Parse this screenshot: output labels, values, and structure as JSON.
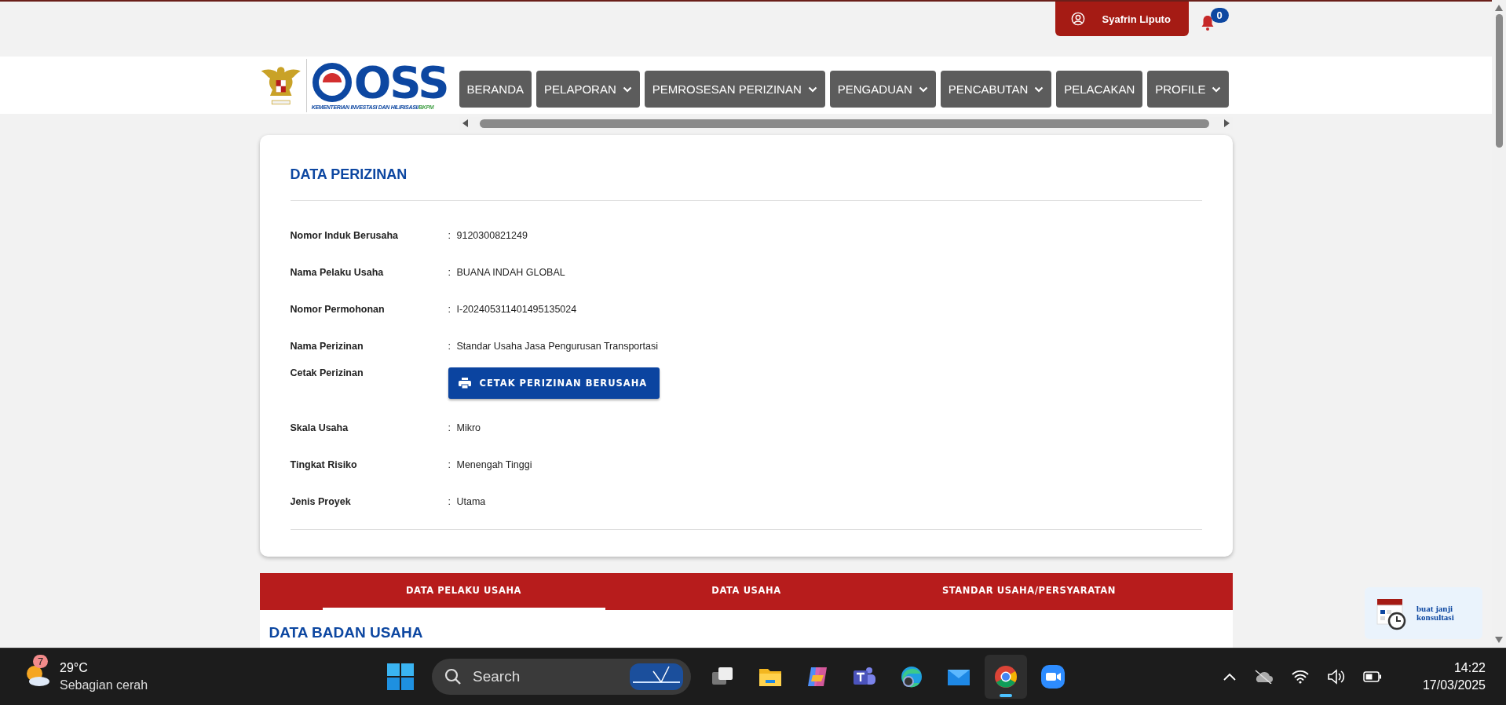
{
  "user_menu": {
    "name": "Syafrin Liputo"
  },
  "notifications": {
    "count": "0"
  },
  "logo": {
    "wordmark": "OSS",
    "caption": "KEMENTERIAN INVESTASI DAN HILIRISASI/",
    "caption_accent": "BKPM"
  },
  "nav": [
    {
      "label": "BERANDA",
      "dropdown": false
    },
    {
      "label": "PELAPORAN",
      "dropdown": true
    },
    {
      "label": "PEMROSESAN PERIZINAN",
      "dropdown": true
    },
    {
      "label": "PENGADUAN",
      "dropdown": true
    },
    {
      "label": "PENCABUTAN",
      "dropdown": true
    },
    {
      "label": "PELACAKAN",
      "dropdown": false
    },
    {
      "label": "PROFILE",
      "dropdown": true
    }
  ],
  "card": {
    "title": "DATA PERIZINAN",
    "rows": [
      {
        "kind": "text",
        "label": "Nomor Induk Berusaha",
        "separator": ":",
        "value": "9120300821249"
      },
      {
        "kind": "text",
        "label": "Nama Pelaku Usaha",
        "separator": ":",
        "value": "BUANA INDAH GLOBAL"
      },
      {
        "kind": "text",
        "label": "Nomor Permohonan",
        "separator": ":",
        "value": "I-202405311401495135024"
      },
      {
        "kind": "text",
        "label": "Nama Perizinan",
        "separator": ":",
        "value": "Standar Usaha Jasa Pengurusan Transportasi"
      },
      {
        "kind": "button",
        "label": "Cetak Perizinan",
        "value": "CETAK PERIZINAN BERUSAHA"
      },
      {
        "kind": "text",
        "label": "Skala Usaha",
        "separator": ":",
        "value": "Mikro"
      },
      {
        "kind": "text",
        "label": "Tingkat Risiko",
        "separator": ":",
        "value": "Menengah Tinggi"
      },
      {
        "kind": "text",
        "label": "Jenis Proyek",
        "separator": ":",
        "value": "Utama"
      }
    ]
  },
  "tabs": [
    {
      "label": "DATA PELAKU USAHA",
      "selected": true
    },
    {
      "label": "DATA USAHA",
      "selected": false
    },
    {
      "label": "STANDAR USAHA/PERSYARATAN",
      "selected": false
    }
  ],
  "section_title": "DATA BADAN USAHA",
  "consult_widget": {
    "text": "buat janji konsultasi"
  },
  "taskbar": {
    "weather": {
      "badge": "7",
      "temperature": "29°C",
      "condition": "Sebagian cerah"
    },
    "search": {
      "placeholder": "Search"
    },
    "apps": [
      {
        "kind": "taskview",
        "active": false
      },
      {
        "kind": "files",
        "active": false
      },
      {
        "kind": "copilot",
        "active": false
      },
      {
        "kind": "teams",
        "active": false
      },
      {
        "kind": "edge",
        "active": false
      },
      {
        "kind": "mail",
        "active": false
      },
      {
        "kind": "chrome",
        "active": true
      },
      {
        "kind": "zoom",
        "active": false
      }
    ],
    "time": "14:22",
    "date": "17/03/2025"
  }
}
